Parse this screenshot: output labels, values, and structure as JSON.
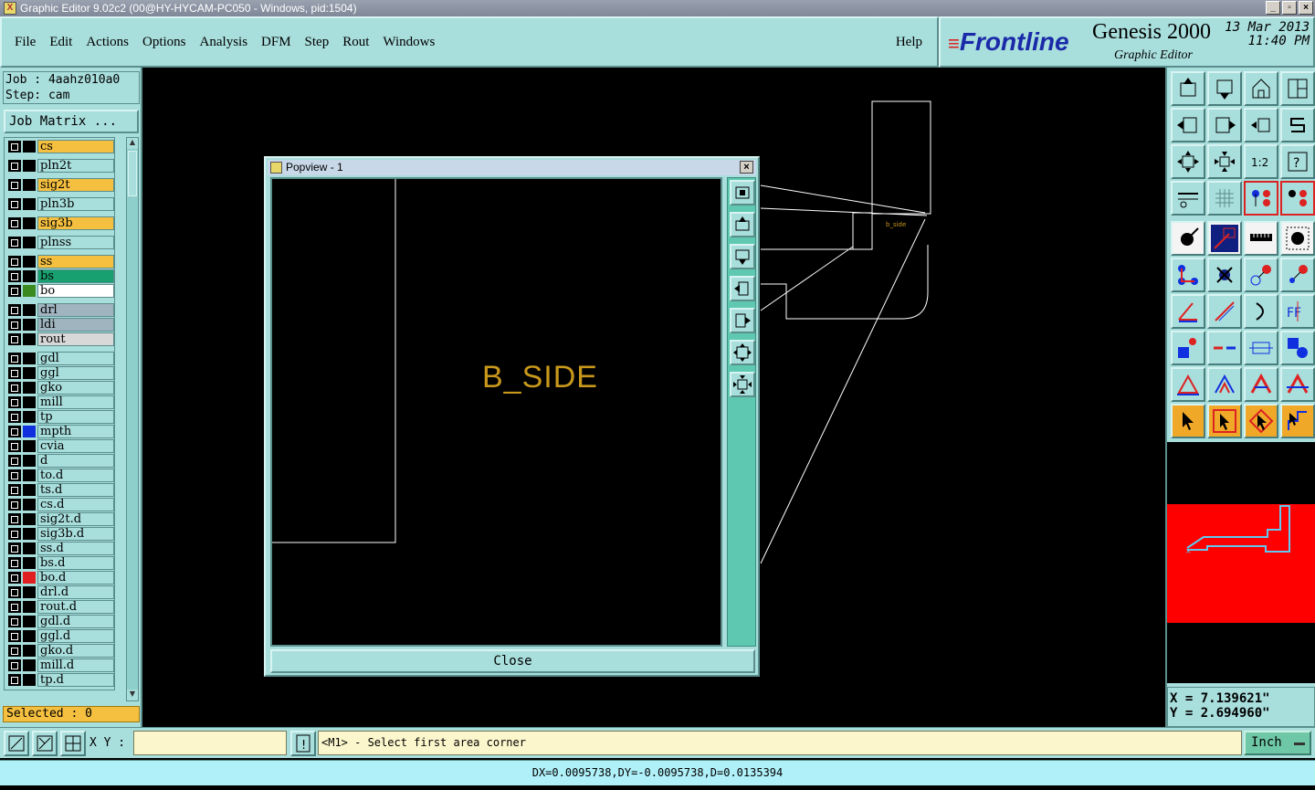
{
  "window": {
    "title": "Graphic Editor 9.02c2 (00@HY-HYCAM-PC050 - Windows, pid:1504)"
  },
  "menu": {
    "items": [
      {
        "label": "File"
      },
      {
        "label": "Edit"
      },
      {
        "label": "Actions"
      },
      {
        "label": "Options"
      },
      {
        "label": "Analysis"
      },
      {
        "label": "DFM"
      },
      {
        "label": "Step"
      },
      {
        "label": "Rout"
      },
      {
        "label": "Windows"
      }
    ],
    "help": "Help"
  },
  "brand": {
    "logo": "Frontline",
    "product": "Genesis 2000",
    "subtitle": "Graphic Editor",
    "date": "13 Mar 2013",
    "time": "11:40 PM"
  },
  "job": {
    "job_line": "Job : 4aahz010a0",
    "step_line": "Step: cam",
    "matrix_button": "Job Matrix ..."
  },
  "layers": [
    {
      "name": "cs",
      "color": "#f5c040",
      "swatch": ""
    },
    {
      "name": "pln2t",
      "color": "#a8dedc",
      "swatch": ""
    },
    {
      "name": "sig2t",
      "color": "#f5c040",
      "swatch": ""
    },
    {
      "name": "pln3b",
      "color": "#a8dedc",
      "swatch": ""
    },
    {
      "name": "sig3b",
      "color": "#f5c040",
      "swatch": ""
    },
    {
      "name": "plnss",
      "color": "#a8dedc",
      "swatch": ""
    },
    {
      "name": "ss",
      "color": "#f5c040",
      "swatch": ""
    },
    {
      "name": "bs",
      "color": "#18a070",
      "swatch": ""
    },
    {
      "name": "bo",
      "color": "#ffffff",
      "swatch": "#3a8a20"
    },
    {
      "name": "drl",
      "color": "#a0b4c0",
      "swatch": ""
    },
    {
      "name": "ldi",
      "color": "#a0b4c0",
      "swatch": ""
    },
    {
      "name": "rout",
      "color": "#d8d8d8",
      "swatch": ""
    },
    {
      "name": "gdl",
      "color": "#a8dedc",
      "swatch": ""
    },
    {
      "name": "ggl",
      "color": "#a8dedc",
      "swatch": ""
    },
    {
      "name": "gko",
      "color": "#a8dedc",
      "swatch": ""
    },
    {
      "name": "mill",
      "color": "#a8dedc",
      "swatch": ""
    },
    {
      "name": "tp",
      "color": "#a8dedc",
      "swatch": ""
    },
    {
      "name": "mpth",
      "color": "#a8dedc",
      "swatch": "#1030e0"
    },
    {
      "name": "cvia",
      "color": "#a8dedc",
      "swatch": ""
    },
    {
      "name": "d",
      "color": "#a8dedc",
      "swatch": ""
    },
    {
      "name": "to.d",
      "color": "#a8dedc",
      "swatch": ""
    },
    {
      "name": "ts.d",
      "color": "#a8dedc",
      "swatch": ""
    },
    {
      "name": "cs.d",
      "color": "#a8dedc",
      "swatch": ""
    },
    {
      "name": "sig2t.d",
      "color": "#a8dedc",
      "swatch": ""
    },
    {
      "name": "sig3b.d",
      "color": "#a8dedc",
      "swatch": ""
    },
    {
      "name": "ss.d",
      "color": "#a8dedc",
      "swatch": ""
    },
    {
      "name": "bs.d",
      "color": "#a8dedc",
      "swatch": ""
    },
    {
      "name": "bo.d",
      "color": "#a8dedc",
      "swatch": "#e02020"
    },
    {
      "name": "drl.d",
      "color": "#a8dedc",
      "swatch": ""
    },
    {
      "name": "rout.d",
      "color": "#a8dedc",
      "swatch": ""
    },
    {
      "name": "gdl.d",
      "color": "#a8dedc",
      "swatch": ""
    },
    {
      "name": "ggl.d",
      "color": "#a8dedc",
      "swatch": ""
    },
    {
      "name": "gko.d",
      "color": "#a8dedc",
      "swatch": ""
    },
    {
      "name": "mill.d",
      "color": "#a8dedc",
      "swatch": ""
    },
    {
      "name": "tp.d",
      "color": "#a8dedc",
      "swatch": ""
    }
  ],
  "selected": "Selected : 0",
  "popview": {
    "title": "Popview - 1",
    "text": "B_SIDE",
    "close_label": "Close"
  },
  "coords": {
    "x": "X = 7.139621\"",
    "y": "Y = 2.694960\""
  },
  "status": {
    "xy_label": "X Y :",
    "xy_value": "",
    "prompt": "<M1> - Select first area corner",
    "unit": "Inch",
    "measure": "DX=0.0095738,DY=-0.0095738,D=0.0135394"
  },
  "colors": {
    "panel": "#a8dedc",
    "accent": "#f5c040",
    "overview": "#ff0000",
    "text_yellow": "#c8981c"
  }
}
